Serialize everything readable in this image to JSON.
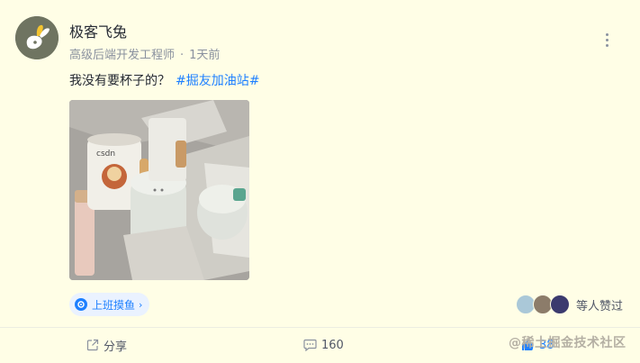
{
  "author": {
    "name": "极客飞兔",
    "title": "高级后端开发工程师",
    "separator": "·",
    "time": "1天前"
  },
  "post": {
    "text": "我没有要杯子的？",
    "topic": "#掘友加油站#"
  },
  "circle": {
    "label": "上班摸鱼",
    "chevron": "›"
  },
  "likes": {
    "summary": "等人赞过"
  },
  "actions": {
    "share_label": "分享",
    "comment_count": "160",
    "like_count": "38"
  },
  "watermark": "@稀土掘金技术社区",
  "colors": {
    "background": "#fffee6",
    "accent": "#1e80ff",
    "text": "#252933",
    "meta": "#8a919f"
  },
  "icons": {
    "more": "more-vertical-icon",
    "share": "share-icon",
    "comment": "comment-icon",
    "like": "thumbs-up-icon",
    "circle": "circle-tag-icon"
  }
}
